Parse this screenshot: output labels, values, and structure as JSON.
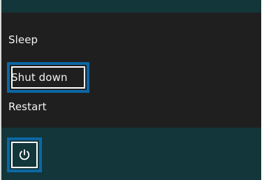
{
  "menu": {
    "items": [
      {
        "label": "Sleep"
      },
      {
        "label": "Shut down"
      },
      {
        "label": "Restart"
      }
    ]
  },
  "power_button": {
    "icon": "power-icon"
  },
  "colors": {
    "accent": "#0c67a5",
    "menu_background": "#1f1f1f",
    "taskbar_background": "#12363a",
    "text": "#f2f2f2",
    "highlight_border": "#ffffff"
  }
}
